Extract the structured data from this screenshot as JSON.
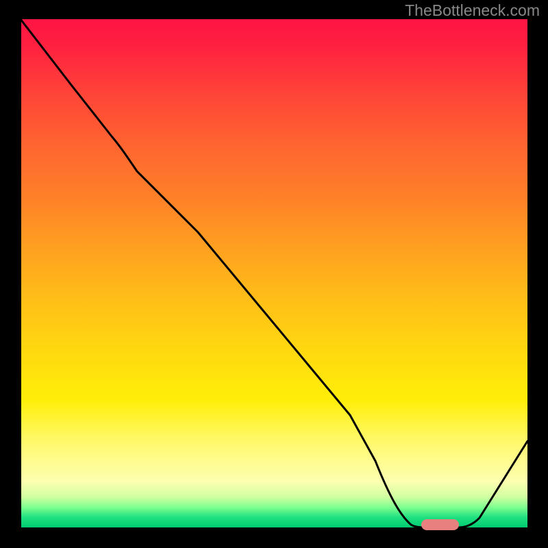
{
  "watermark": "TheBottleneck.com",
  "chart_data": {
    "type": "line",
    "title": "",
    "xlabel": "",
    "ylabel": "",
    "xlim": [
      0,
      100
    ],
    "ylim": [
      0,
      100
    ],
    "series": [
      {
        "name": "curve",
        "x": [
          0,
          10,
          18,
          25,
          35,
          45,
          55,
          65,
          70,
          75,
          80,
          85,
          100
        ],
        "values": [
          100,
          87,
          77,
          70,
          58,
          46,
          34,
          22,
          12,
          4,
          0,
          0,
          17
        ]
      }
    ],
    "marker": {
      "x_start": 80,
      "x_end": 87,
      "y": 0,
      "color": "#e88080"
    },
    "gradient_description": "vertical red-to-green heatmap background",
    "grid": false
  }
}
